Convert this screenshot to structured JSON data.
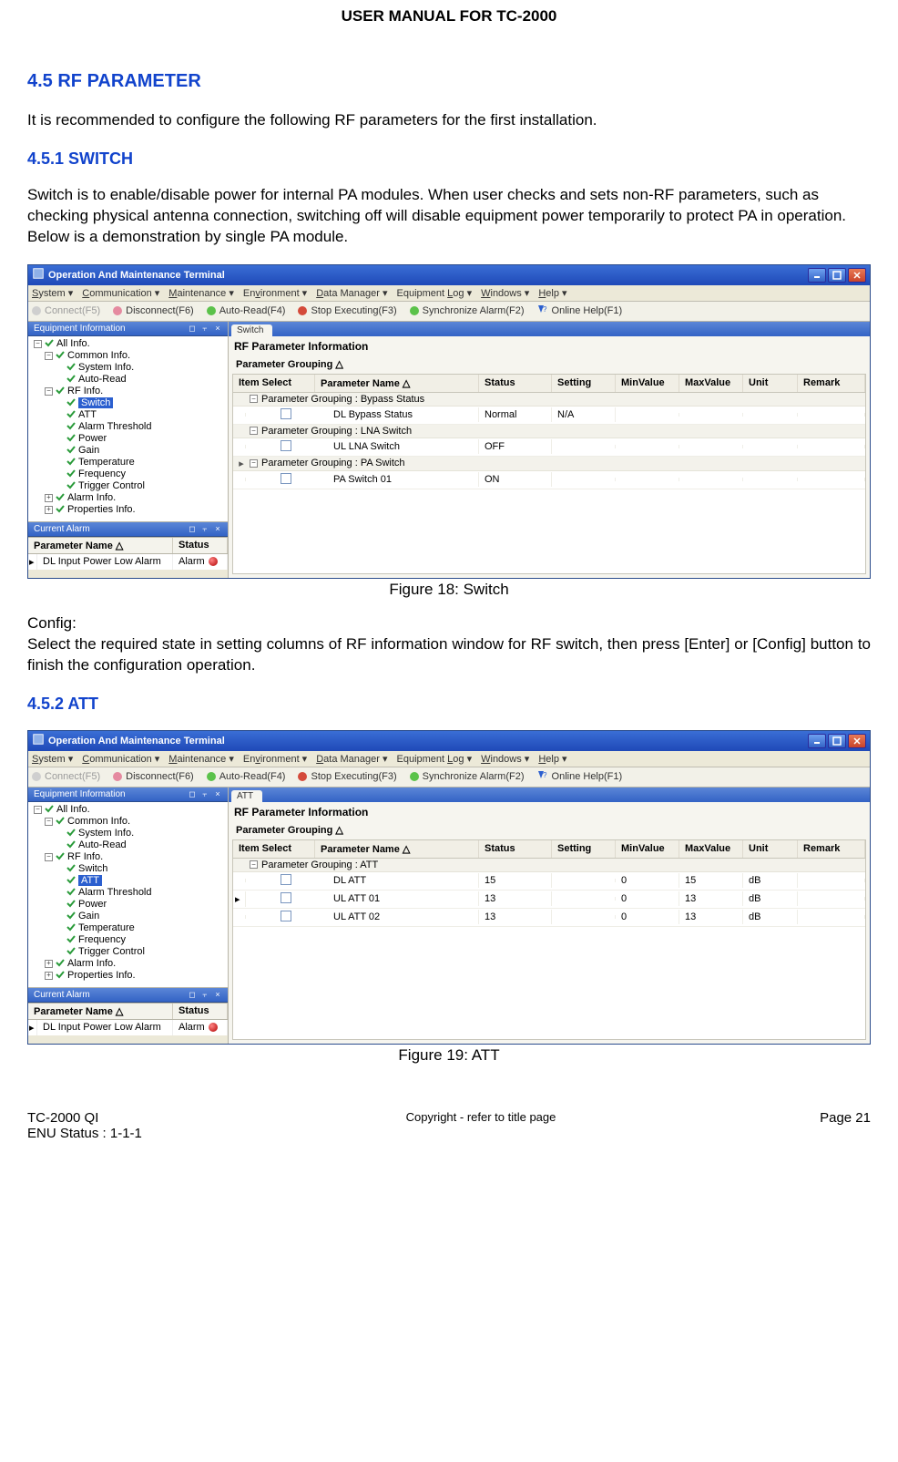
{
  "header": "USER MANUAL FOR TC-2000",
  "sections": {
    "s45": "4.5  RF PARAMETER",
    "s45_intro": "It is recommended to configure the following RF parameters for the first installation.",
    "s451": "4.5.1  SWITCH",
    "s451_body": "Switch is to enable/disable power for internal PA modules. When user checks and sets non-RF parameters, such as checking physical antenna connection, switching off will disable equipment power temporarily to protect PA in operation.  Below is a demonstration by single PA module.",
    "fig18": "Figure 18: Switch",
    "config_label": "Config:",
    "config_body": "Select the required state in setting columns of RF information window for RF switch, then press [Enter] or [Config] button to finish the configuration operation.",
    "s452": "4.5.2  ATT",
    "fig19": "Figure 19: ATT"
  },
  "app": {
    "title": "Operation And Maintenance Terminal",
    "menu": [
      "System",
      "Communication",
      "Maintenance",
      "Environment",
      "Data Manager",
      "Equipment Log",
      "Windows",
      "Help"
    ],
    "toolbar": {
      "connect": "Connect(F5)",
      "disconnect": "Disconnect(F6)",
      "autoread": "Auto-Read(F4)",
      "stop": "Stop Executing(F3)",
      "sync": "Synchronize Alarm(F2)",
      "help": "Online Help(F1)"
    },
    "panels": {
      "equip_info": "Equipment Information",
      "current_alarm": "Current Alarm"
    },
    "tree": {
      "all": "All Info.",
      "common": "Common Info.",
      "system": "System Info.",
      "autoread": "Auto-Read",
      "rf": "RF Info.",
      "switch": "Switch",
      "att": "ATT",
      "alarm_th": "Alarm Threshold",
      "power": "Power",
      "gain": "Gain",
      "temperature": "Temperature",
      "frequency": "Frequency",
      "trigger": "Trigger Control",
      "alarm_info": "Alarm Info.",
      "prop_info": "Properties Info."
    },
    "alarm_table": {
      "h1": "Parameter Name",
      "h2": "Status",
      "row_name": "DL Input Power Low Alarm",
      "row_status": "Alarm"
    },
    "grid": {
      "tab_switch": "Switch",
      "tab_att": "ATT",
      "title": "RF Parameter Information",
      "subtitle": "Parameter Grouping",
      "headers": {
        "item": "Item Select",
        "pname": "Parameter Name",
        "status": "Status",
        "setting": "Setting",
        "min": "MinValue",
        "max": "MaxValue",
        "unit": "Unit",
        "remark": "Remark"
      },
      "switch_groups": [
        {
          "label": "Parameter Grouping : Bypass Status",
          "rows": [
            {
              "name": "DL Bypass Status",
              "status": "Normal",
              "setting": "N/A",
              "min": "",
              "max": "",
              "unit": ""
            }
          ]
        },
        {
          "label": "Parameter Grouping : LNA Switch",
          "rows": [
            {
              "name": "UL LNA Switch",
              "status": "OFF",
              "setting": "",
              "min": "",
              "max": "",
              "unit": ""
            }
          ]
        },
        {
          "label": "Parameter Grouping : PA Switch",
          "pointer": true,
          "rows": [
            {
              "name": "PA Switch 01",
              "status": "ON",
              "setting": "",
              "min": "",
              "max": "",
              "unit": ""
            }
          ]
        }
      ],
      "att_groups": [
        {
          "label": "Parameter Grouping : ATT",
          "rows": [
            {
              "name": "DL ATT",
              "status": "15",
              "setting": "",
              "min": "0",
              "max": "15",
              "unit": "dB"
            },
            {
              "name": "UL ATT 01",
              "status": "13",
              "setting": "",
              "min": "0",
              "max": "13",
              "unit": "dB",
              "pointer": true
            },
            {
              "name": "UL ATT 02",
              "status": "13",
              "setting": "",
              "min": "0",
              "max": "13",
              "unit": "dB"
            }
          ]
        }
      ]
    }
  },
  "footer": {
    "left1": "TC-2000 QI",
    "left2": "ENU Status : 1-1-1",
    "center": "Copyright - refer to title page",
    "right": "Page 21"
  }
}
